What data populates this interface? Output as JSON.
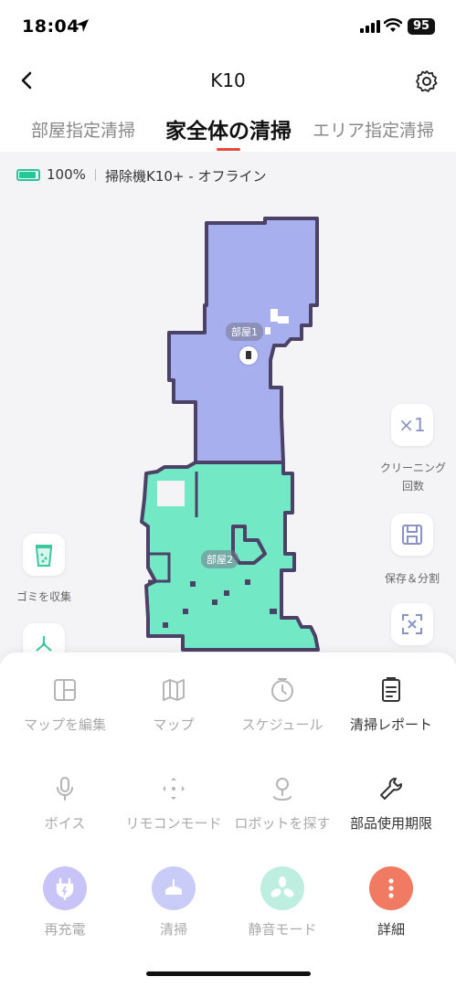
{
  "status_bar": {
    "time": "18:04",
    "battery": "95"
  },
  "nav": {
    "title": "K10"
  },
  "tabs": [
    {
      "label": "部屋指定清掃",
      "active": false
    },
    {
      "label": "家全体の清掃",
      "active": true
    },
    {
      "label": "エリア指定清掃",
      "active": false
    }
  ],
  "device": {
    "battery_percent": "100%",
    "status": "掃除機K10+ - オフライン"
  },
  "map": {
    "rooms": [
      {
        "label": "部屋1",
        "color": "#a7afef"
      },
      {
        "label": "部屋2",
        "color": "#72e8c5"
      }
    ],
    "wall_color": "#4c4166"
  },
  "side_buttons": {
    "cleaning_times": {
      "value": "×1",
      "label": "クリーニング回数"
    },
    "save_split": {
      "label": "保存＆分割"
    },
    "empty_dust": {
      "label": "ゴミを収集"
    }
  },
  "features_row1": [
    {
      "label": "マップを編集",
      "icon": "map-edit-icon",
      "enabled": false
    },
    {
      "label": "マップ",
      "icon": "map-icon",
      "enabled": false
    },
    {
      "label": "スケジュール",
      "icon": "clock-icon",
      "enabled": false
    },
    {
      "label": "清掃レポート",
      "icon": "report-icon",
      "enabled": true
    }
  ],
  "features_row2": [
    {
      "label": "ボイス",
      "icon": "microphone-icon",
      "enabled": false
    },
    {
      "label": "リモコンモード",
      "icon": "remote-control-icon",
      "enabled": false
    },
    {
      "label": "ロボットを探す",
      "icon": "location-pin-icon",
      "enabled": false
    },
    {
      "label": "部品使用期限",
      "icon": "wrench-icon",
      "enabled": true
    }
  ],
  "actions": [
    {
      "label": "再充電",
      "icon": "charge-plug-icon",
      "color": "#c9c4f7",
      "enabled": false
    },
    {
      "label": "清掃",
      "icon": "vacuum-icon",
      "color": "#c9ccf6",
      "enabled": false
    },
    {
      "label": "静音モード",
      "icon": "fan-icon",
      "color": "#bdeee0",
      "enabled": false
    },
    {
      "label": "詳細",
      "icon": "more-vertical-icon",
      "color": "#f07a62",
      "enabled": true
    }
  ]
}
